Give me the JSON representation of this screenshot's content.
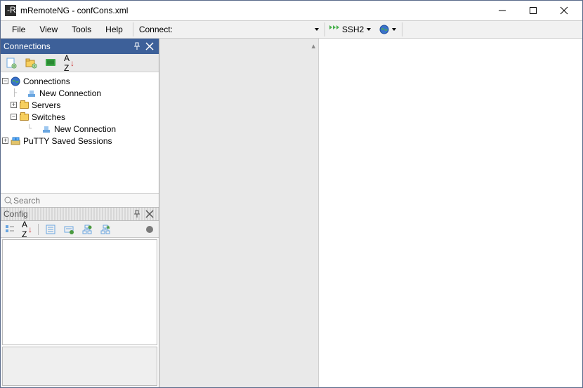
{
  "window": {
    "title": "mRemoteNG - confCons.xml",
    "app_initials": "-R"
  },
  "menu": {
    "file": "File",
    "view": "View",
    "tools": "Tools",
    "help": "Help",
    "connect_label": "Connect:"
  },
  "quick": {
    "protocol": "SSH2",
    "host_placeholder": ""
  },
  "connections_panel": {
    "title": "Connections"
  },
  "search": {
    "placeholder": "Search"
  },
  "config_panel": {
    "title": "Config"
  },
  "tree": {
    "root": "Connections",
    "new_conn_1": "New Connection",
    "servers": "Servers",
    "switches": "Switches",
    "new_conn_2": "New Connection",
    "putty": "PuTTY Saved Sessions"
  },
  "sort_letters": {
    "a": "A",
    "z": "Z"
  }
}
